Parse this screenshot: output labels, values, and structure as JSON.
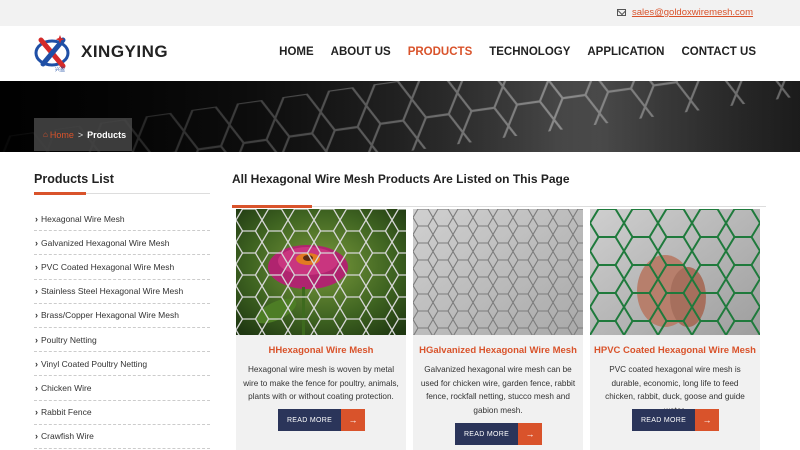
{
  "topbar": {
    "email": "sales@goldoxwiremesh.com",
    "mail_icon": "envelope-icon"
  },
  "header": {
    "brand": "XINGYING",
    "logo_subtext": "兴盈",
    "nav": [
      {
        "label": "HOME",
        "active": false
      },
      {
        "label": "ABOUT US",
        "active": false
      },
      {
        "label": "PRODUCTS",
        "active": true
      },
      {
        "label": "TECHNOLOGY",
        "active": false
      },
      {
        "label": "APPLICATION",
        "active": false
      },
      {
        "label": "CONTACT US",
        "active": false
      }
    ]
  },
  "breadcrumb": {
    "home": "Home",
    "separator": ">",
    "current": "Products"
  },
  "sidebar": {
    "title": "Products List",
    "items": [
      "Hexagonal Wire Mesh",
      "Galvanized Hexagonal Wire Mesh",
      "PVC Coated Hexagonal Wire Mesh",
      "Stainless Steel Hexagonal Wire Mesh",
      "Brass/Copper Hexagonal Wire Mesh",
      "Poultry Netting",
      "Vinyl Coated Poultry Netting",
      "Chicken Wire",
      "Rabbit Fence",
      "Crawfish Wire"
    ]
  },
  "main": {
    "heading": "All Hexagonal Wire Mesh Products Are Listed on This Page",
    "cards": [
      {
        "title": "HHexagonal Wire Mesh",
        "desc": "Hexagonal wire mesh is woven by metal wire to make the fence for poultry, animals, plants with or without coating protection.",
        "button": "READ MORE"
      },
      {
        "title": "HGalvanized Hexagonal Wire Mesh",
        "desc": "Galvanized hexagonal wire mesh can be used for chicken wire, garden fence, rabbit fence, rockfall netting, stucco mesh and gabion mesh.",
        "button": "READ MORE"
      },
      {
        "title": "HPVC Coated Hexagonal Wire Mesh",
        "desc": "PVC coated hexagonal wire mesh is durable, economic, long life to feed chicken, rabbit, duck, goose and guide water.",
        "button": "READ MORE"
      }
    ]
  },
  "colors": {
    "accent": "#d9532b",
    "button_navy": "#2b355a",
    "card_bg": "#f1f1f1"
  }
}
